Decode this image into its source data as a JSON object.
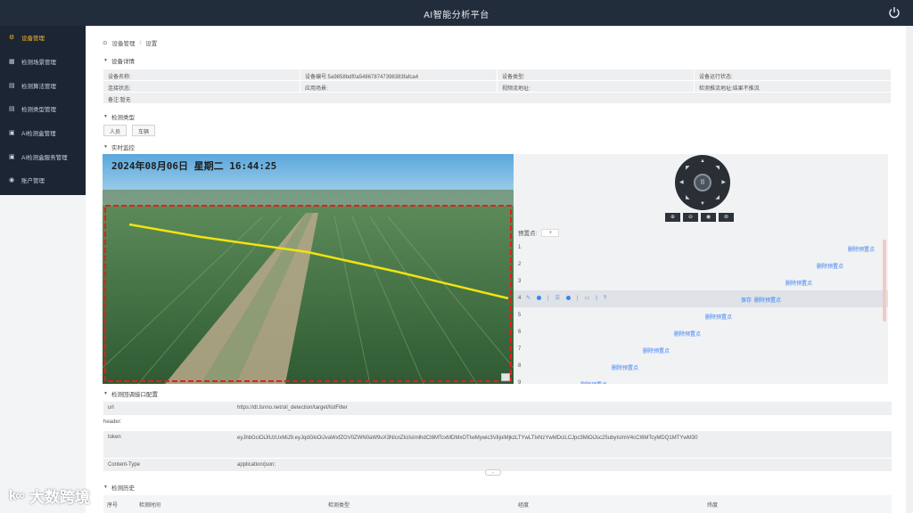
{
  "app": {
    "title": "AI智能分析平台"
  },
  "colors": {
    "topbar": "#222d3c",
    "sidebar": "#1b2533",
    "accent_active": "#f1b92c",
    "link": "#3b82f6",
    "roi_box": "#e0201b",
    "line": "#f2e30f"
  },
  "sidebar": {
    "items": [
      {
        "label": "设备管理",
        "icon": "settings-icon",
        "active": true
      },
      {
        "label": "检测场景管理",
        "icon": "grid-icon",
        "active": false
      },
      {
        "label": "检测算法管理",
        "icon": "doc-icon",
        "active": false
      },
      {
        "label": "检测类型管理",
        "icon": "doc-icon",
        "active": false
      },
      {
        "label": "AI检测盒管理",
        "icon": "box-icon",
        "active": false
      },
      {
        "label": "AI检测盒服务管理",
        "icon": "box-icon",
        "active": false
      },
      {
        "label": "账户管理",
        "icon": "user-icon",
        "active": false
      }
    ]
  },
  "breadcrumb": {
    "parent": "设备管理",
    "sep": "/",
    "current": "设置"
  },
  "sections": {
    "details": "设备详情",
    "detect_type": "检测类型",
    "monitor": "实时监控",
    "callback": "检测回调接口配置",
    "history": "检测历史"
  },
  "details": {
    "row1": [
      "设备名称:",
      "设备编号:5a9858bdf0a548678747398383fafca4",
      "设备类型:",
      "设备运行状态:"
    ],
    "row2": [
      "连接状态:",
      "应用场景:",
      "视频流地址:",
      "检测推流地址:结果不推流"
    ],
    "row3": "备注:暂无"
  },
  "detect_types": [
    "人员",
    "车辆"
  ],
  "video": {
    "timestamp": "2024年08月06日  星期二  16:44:25"
  },
  "ptz": {
    "center_symbol": "II",
    "controls": [
      "⊕",
      "⊖",
      "◉",
      "⊛"
    ],
    "preset_label": "预置点:",
    "preset_add": "+",
    "presets": [
      {
        "num": "1",
        "action": "删除预置点"
      },
      {
        "num": "2",
        "action": "删除预置点"
      },
      {
        "num": "3",
        "action": "删除预置点"
      },
      {
        "num": "4",
        "action": "删除预置点",
        "extra": "保存"
      },
      {
        "num": "5",
        "action": "删除预置点"
      },
      {
        "num": "6",
        "action": "删除预置点"
      },
      {
        "num": "7",
        "action": "删除预置点"
      },
      {
        "num": "8",
        "action": "删除预置点"
      },
      {
        "num": "9",
        "action": "删除预置点"
      }
    ]
  },
  "callback": {
    "url_label": "url",
    "url_value": "https://dt.lsnno.net/oil_detection/target/listFilter",
    "header_label": "header:",
    "token_label": "token",
    "token_value": "eyJhbGciOiJIUzUxMiJ9.eyJqdGkiOiJvaWxfZGV0ZWN0aW9uX3NlcnZlciIsImlhdCI6MTcxMDMxOTIwMywic3ViIjoiMjkzLTYwLTIxNzYwMDciLCJpc3MiOiJsc25ubyIsImV4cCI6MTcyMDQ1MTYwM30",
    "content_type_label": "Content-Type",
    "content_type_value": "application/json;"
  },
  "history": {
    "columns": [
      "序号",
      "检测时间",
      "检测类型",
      "经度",
      "纬度"
    ]
  },
  "watermark": {
    "logo": "k∞",
    "text": "大数跨境"
  }
}
